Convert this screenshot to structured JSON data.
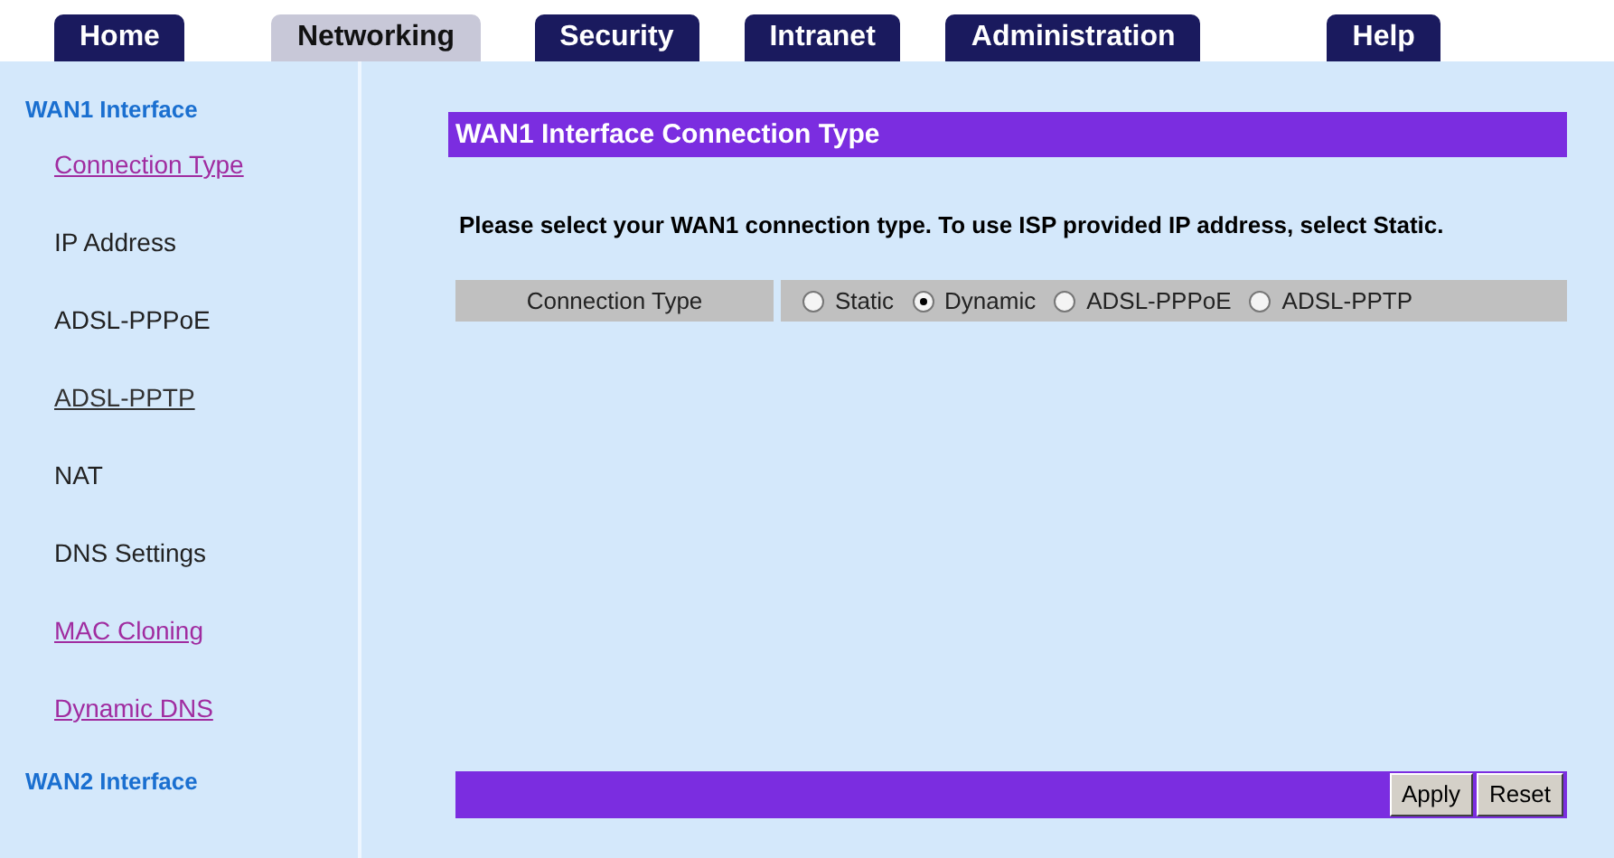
{
  "tabs": [
    {
      "label": "Home",
      "selected": false
    },
    {
      "label": "Networking",
      "selected": true
    },
    {
      "label": "Security",
      "selected": false
    },
    {
      "label": "Intranet",
      "selected": false
    },
    {
      "label": "Administration",
      "selected": false
    },
    {
      "label": "Help",
      "selected": false
    }
  ],
  "sidebar": {
    "items": [
      {
        "label": "WAN1 Interface",
        "kind": "heading"
      },
      {
        "label": "Connection Type",
        "kind": "visited_link"
      },
      {
        "label": "IP Address",
        "kind": "text"
      },
      {
        "label": "ADSL-PPPoE",
        "kind": "text"
      },
      {
        "label": "ADSL-PPTP",
        "kind": "link"
      },
      {
        "label": "NAT",
        "kind": "text"
      },
      {
        "label": "DNS Settings",
        "kind": "text"
      },
      {
        "label": "MAC Cloning",
        "kind": "visited_link"
      },
      {
        "label": "Dynamic DNS",
        "kind": "visited_link"
      },
      {
        "label": "WAN2 Interface",
        "kind": "heading"
      }
    ]
  },
  "title": "WAN1 Interface Connection Type",
  "instruction": "Please select your WAN1 connection type. To use ISP provided IP address, select Static.",
  "connection_type": {
    "label": "Connection Type",
    "options": [
      {
        "label": "Static",
        "selected": false
      },
      {
        "label": "Dynamic",
        "selected": true
      },
      {
        "label": "ADSL-PPPoE",
        "selected": false
      },
      {
        "label": "ADSL-PPTP",
        "selected": false
      }
    ]
  },
  "buttons": [
    "Apply",
    "Reset"
  ]
}
